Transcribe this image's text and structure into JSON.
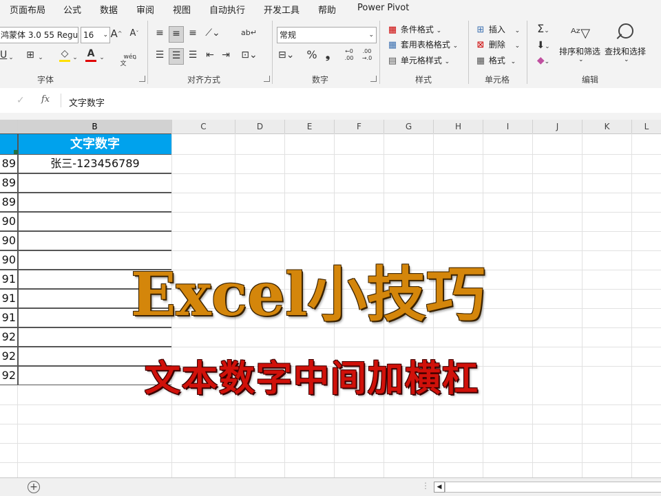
{
  "menu": [
    "页面布局",
    "公式",
    "数据",
    "审阅",
    "视图",
    "自动执行",
    "开发工具",
    "帮助",
    "Power Pivot"
  ],
  "ribbon": {
    "font": {
      "name": "鸿蒙体 3.0 55 Regu",
      "size": "16",
      "grow_glyph": "A",
      "shrink_glyph": "A",
      "phonetic": "wén\n文",
      "label": "字体"
    },
    "align": {
      "label": "对齐方式"
    },
    "number": {
      "format": "常规",
      "percent": "%",
      "comma": "❟",
      "inc_decimal": "←0\n.00",
      "dec_decimal": ".00\n→.0",
      "label": "数字"
    },
    "styles": {
      "conditional": "条件格式",
      "table": "套用表格格式",
      "cell": "单元格样式",
      "label": "样式"
    },
    "cells": {
      "insert": "插入",
      "delete": "删除",
      "format": "格式",
      "label": "单元格"
    },
    "editing": {
      "sort": "排序和筛选",
      "find": "查找和选择",
      "label": "编辑"
    }
  },
  "formula_bar": {
    "content": "文字数字",
    "fx": "fx"
  },
  "sheet": {
    "columns": [
      "B",
      "C",
      "D",
      "E",
      "F",
      "G",
      "H",
      "I",
      "J",
      "K",
      "L"
    ],
    "header_text": "文字数字",
    "b2": "张三-123456789",
    "a_col": [
      "89",
      "89",
      "89",
      "90",
      "90",
      "90",
      "91",
      "91",
      "91",
      "92",
      "92",
      "92"
    ]
  },
  "overlay": {
    "title": "Excel小技巧",
    "subtitle": "文本数字中间加横杠"
  },
  "colors": {
    "header_fill": "#00a2ed",
    "title": "#d4860b",
    "subtitle": "#d0110a"
  }
}
